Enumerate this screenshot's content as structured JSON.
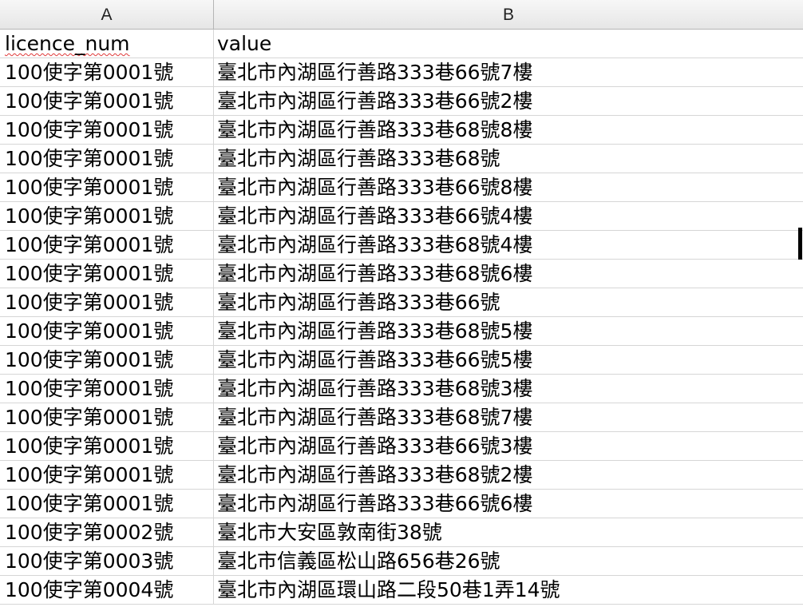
{
  "columns": [
    "A",
    "B"
  ],
  "header_row": {
    "a": "licence_num",
    "b": "value"
  },
  "rows": [
    {
      "a": "100使字第0001號",
      "b": "臺北市內湖區行善路333巷66號7樓"
    },
    {
      "a": "100使字第0001號",
      "b": "臺北市內湖區行善路333巷66號2樓"
    },
    {
      "a": "100使字第0001號",
      "b": "臺北市內湖區行善路333巷68號8樓"
    },
    {
      "a": "100使字第0001號",
      "b": "臺北市內湖區行善路333巷68號"
    },
    {
      "a": "100使字第0001號",
      "b": "臺北市內湖區行善路333巷66號8樓"
    },
    {
      "a": "100使字第0001號",
      "b": "臺北市內湖區行善路333巷66號4樓"
    },
    {
      "a": "100使字第0001號",
      "b": "臺北市內湖區行善路333巷68號4樓"
    },
    {
      "a": "100使字第0001號",
      "b": "臺北市內湖區行善路333巷68號6樓"
    },
    {
      "a": "100使字第0001號",
      "b": "臺北市內湖區行善路333巷66號"
    },
    {
      "a": "100使字第0001號",
      "b": "臺北市內湖區行善路333巷68號5樓"
    },
    {
      "a": "100使字第0001號",
      "b": "臺北市內湖區行善路333巷66號5樓"
    },
    {
      "a": "100使字第0001號",
      "b": "臺北市內湖區行善路333巷68號3樓"
    },
    {
      "a": "100使字第0001號",
      "b": "臺北市內湖區行善路333巷68號7樓"
    },
    {
      "a": "100使字第0001號",
      "b": "臺北市內湖區行善路333巷66號3樓"
    },
    {
      "a": "100使字第0001號",
      "b": "臺北市內湖區行善路333巷68號2樓"
    },
    {
      "a": "100使字第0001號",
      "b": "臺北市內湖區行善路333巷66號6樓"
    },
    {
      "a": "100使字第0002號",
      "b": "臺北市大安區敦南街38號"
    },
    {
      "a": "100使字第0003號",
      "b": "臺北市信義區松山路656巷26號"
    },
    {
      "a": "100使字第0004號",
      "b": "臺北市內湖區環山路二段50巷1弄14號"
    }
  ]
}
